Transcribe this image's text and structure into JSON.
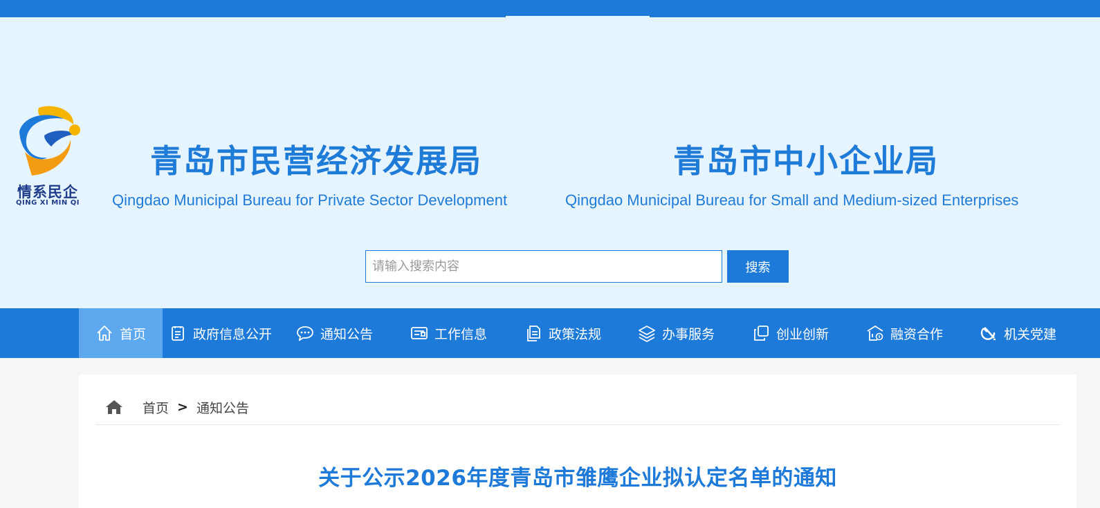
{
  "header": {
    "logo": {
      "cn": "情系民企",
      "en": "QING XI MIN QI"
    },
    "bureau_left": {
      "cn": "青岛市民营经济发展局",
      "en": "Qingdao Municipal Bureau for Private Sector Development"
    },
    "bureau_right": {
      "cn": "青岛市中小企业局",
      "en": "Qingdao Municipal Bureau for Small and Medium-sized Enterprises"
    }
  },
  "search": {
    "placeholder": "请输入搜索内容",
    "value": "",
    "button_label": "搜索"
  },
  "nav": {
    "items": [
      {
        "label": "首页",
        "icon": "home-icon",
        "active": true
      },
      {
        "label": "政府信息公开",
        "icon": "document-list-icon"
      },
      {
        "label": "通知公告",
        "icon": "chat-bubble-icon"
      },
      {
        "label": "工作信息",
        "icon": "id-card-icon"
      },
      {
        "label": "政策法规",
        "icon": "documents-icon"
      },
      {
        "label": "办事服务",
        "icon": "layers-icon"
      },
      {
        "label": "创业创新",
        "icon": "copy-icon"
      },
      {
        "label": "融资合作",
        "icon": "bank-icon"
      },
      {
        "label": "机关党建",
        "icon": "hammer-sickle-icon"
      }
    ]
  },
  "breadcrumb": {
    "home": "首页",
    "separator": ">",
    "current": "通知公告"
  },
  "article": {
    "title": "关于公示2026年度青岛市雏鹰企业拟认定名单的通知"
  },
  "colors": {
    "brand_blue": "#1e7ad9",
    "header_bg": "#e6f4ff",
    "nav_active": "#5ea8ef"
  }
}
